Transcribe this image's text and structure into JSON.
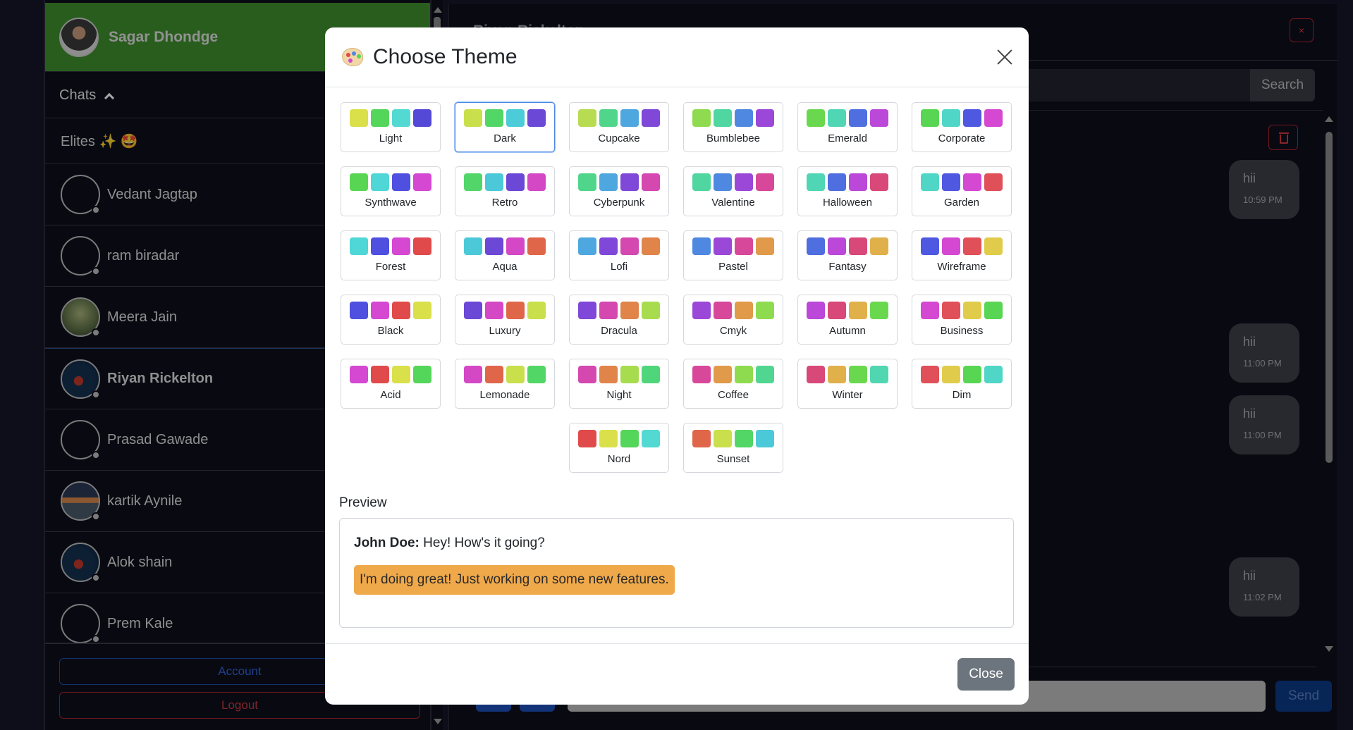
{
  "sidebar": {
    "profile": {
      "name": "Sagar Dhondge"
    },
    "chats_label": "Chats",
    "group": {
      "name": "Elites ✨ 🤩"
    },
    "contacts": [
      {
        "name": "Vedant Jagtap"
      },
      {
        "name": "ram biradar"
      },
      {
        "name": "Meera Jain"
      },
      {
        "name": "Riyan Rickelton"
      },
      {
        "name": "Prasad Gawade"
      },
      {
        "name": "kartik Aynile"
      },
      {
        "name": "Alok shain"
      },
      {
        "name": "Prem Kale"
      }
    ],
    "account_label": "Account",
    "logout_label": "Logout"
  },
  "chat": {
    "header_title": "Riyan Rickelton",
    "close_symbol": "×",
    "search_button": "Search",
    "send_button": "Send",
    "messages": [
      {
        "text": "hii",
        "time": "10:59 PM"
      },
      {
        "text": "hii",
        "time": "11:00 PM"
      },
      {
        "text": "hii",
        "time": "11:00 PM"
      },
      {
        "text": "hii",
        "time": "11:02 PM"
      }
    ]
  },
  "modal": {
    "title": "Choose Theme",
    "selected_theme": "Dark",
    "themes": [
      {
        "name": "Light",
        "colors": [
          "#d9e04a",
          "#54d65a",
          "#52d9d2",
          "#5449d6"
        ]
      },
      {
        "name": "Dark",
        "colors": [
          "#c9df4b",
          "#52d665",
          "#4ccbd9",
          "#6b48d6"
        ]
      },
      {
        "name": "Cupcake",
        "colors": [
          "#b7dc52",
          "#50d68a",
          "#4fa7e0",
          "#7f48d8"
        ]
      },
      {
        "name": "Bumblebee",
        "colors": [
          "#8fdb4f",
          "#50d6a0",
          "#4f88e0",
          "#9b48d8"
        ]
      },
      {
        "name": "Emerald",
        "colors": [
          "#6ad84f",
          "#50d6b4",
          "#4f6ee0",
          "#bb48d8"
        ]
      },
      {
        "name": "Corporate",
        "colors": [
          "#58d653",
          "#50d6c6",
          "#4f58e0",
          "#d448d2"
        ]
      },
      {
        "name": "Synthwave",
        "colors": [
          "#58d653",
          "#4fd6d6",
          "#4f4fe0",
          "#d448d2"
        ]
      },
      {
        "name": "Retro",
        "colors": [
          "#52d66a",
          "#4cc9d9",
          "#6b48d6",
          "#d448c6"
        ]
      },
      {
        "name": "Cyberpunk",
        "colors": [
          "#50d68a",
          "#4fa7e0",
          "#7f48d8",
          "#d448b0"
        ]
      },
      {
        "name": "Valentine",
        "colors": [
          "#50d6a0",
          "#4f88e0",
          "#9b48d8",
          "#d8489a"
        ]
      },
      {
        "name": "Halloween",
        "colors": [
          "#50d6b4",
          "#4f6ee0",
          "#bb48d8",
          "#d84878"
        ]
      },
      {
        "name": "Garden",
        "colors": [
          "#50d6c6",
          "#4f58e0",
          "#d448d2",
          "#e05058"
        ]
      },
      {
        "name": "Forest",
        "colors": [
          "#4fd6d6",
          "#4f4fe0",
          "#d448d2",
          "#e04a4a"
        ]
      },
      {
        "name": "Aqua",
        "colors": [
          "#4cc9d9",
          "#6b48d6",
          "#d448c6",
          "#e0664a"
        ]
      },
      {
        "name": "Lofi",
        "colors": [
          "#4fa7e0",
          "#7f48d8",
          "#d448b0",
          "#e0844a"
        ]
      },
      {
        "name": "Pastel",
        "colors": [
          "#4f88e0",
          "#9b48d8",
          "#d8489a",
          "#e09a4a"
        ]
      },
      {
        "name": "Fantasy",
        "colors": [
          "#4f6ee0",
          "#bb48d8",
          "#d84878",
          "#e0b04a"
        ]
      },
      {
        "name": "Wireframe",
        "colors": [
          "#4f58e0",
          "#d448d2",
          "#e05058",
          "#e0cc4a"
        ]
      },
      {
        "name": "Black",
        "colors": [
          "#4f4fe0",
          "#d448d2",
          "#e04a4a",
          "#d9e04a"
        ]
      },
      {
        "name": "Luxury",
        "colors": [
          "#6b48d6",
          "#d448c6",
          "#e0664a",
          "#c9df4b"
        ]
      },
      {
        "name": "Dracula",
        "colors": [
          "#7f48d8",
          "#d448b0",
          "#e0844a",
          "#a8dc4f"
        ]
      },
      {
        "name": "Cmyk",
        "colors": [
          "#9b48d8",
          "#d8489a",
          "#e09a4a",
          "#8fdb4f"
        ]
      },
      {
        "name": "Autumn",
        "colors": [
          "#bb48d8",
          "#d84878",
          "#e0b04a",
          "#6ad84f"
        ]
      },
      {
        "name": "Business",
        "colors": [
          "#d448d2",
          "#e05058",
          "#e0cc4a",
          "#58d653"
        ]
      },
      {
        "name": "Acid",
        "colors": [
          "#d448d2",
          "#e04a4a",
          "#d9e04a",
          "#54d65a"
        ]
      },
      {
        "name": "Lemonade",
        "colors": [
          "#d448c6",
          "#e0664a",
          "#c9df4b",
          "#52d665"
        ]
      },
      {
        "name": "Night",
        "colors": [
          "#d448b0",
          "#e0844a",
          "#a8dc4f",
          "#50d67a"
        ]
      },
      {
        "name": "Coffee",
        "colors": [
          "#d8489a",
          "#e09a4a",
          "#8fdb4f",
          "#50d690"
        ]
      },
      {
        "name": "Winter",
        "colors": [
          "#d84878",
          "#e0b04a",
          "#6ad84f",
          "#50d6b0"
        ]
      },
      {
        "name": "Dim",
        "colors": [
          "#e05058",
          "#e0cc4a",
          "#58d653",
          "#50d6c6"
        ]
      },
      {
        "name": "Nord",
        "colors": [
          "#e04a4a",
          "#d9e04a",
          "#54d65a",
          "#52d9d2"
        ]
      },
      {
        "name": "Sunset",
        "colors": [
          "#e0664a",
          "#c9df4b",
          "#52d665",
          "#4cc9d9"
        ]
      }
    ],
    "preview": {
      "label": "Preview",
      "sender": "John Doe:",
      "message": "Hey! How's it going?",
      "reply": "I'm doing great! Just working on some new features."
    },
    "close_button": "Close"
  }
}
